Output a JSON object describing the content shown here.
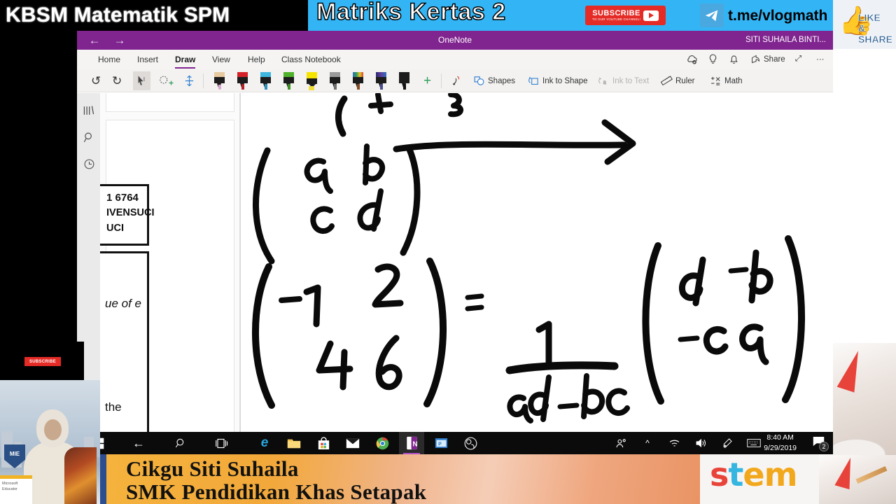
{
  "banner": {
    "channel_title": "KBSM Matematik SPM",
    "topic_title": "Matriks Kertas 2",
    "subscribe_main": "SUBSCRIBE",
    "subscribe_sub": "TO OUR YOUTUBE CHANNEL!",
    "telegram_handle": "t.me/vlogmath",
    "like_share_line1": "LIKE",
    "like_share_line2": "& SHARE"
  },
  "window": {
    "app_title": "OneNote",
    "account_name": "SITI SUHAILA BINTI...",
    "back_arrow": "←",
    "forward_arrow": "→"
  },
  "ribbon": {
    "tabs": [
      {
        "label": "Home",
        "active": false
      },
      {
        "label": "Insert",
        "active": false
      },
      {
        "label": "Draw",
        "active": true
      },
      {
        "label": "View",
        "active": false
      },
      {
        "label": "Help",
        "active": false
      },
      {
        "label": "Class Notebook",
        "active": false
      }
    ],
    "title_icons": [
      {
        "name": "sync-cloud-icon",
        "glyph": "☁"
      },
      {
        "name": "tell-me-lightbulb-icon",
        "glyph": "◯"
      },
      {
        "name": "notifications-bell-icon",
        "glyph": "🔔"
      }
    ],
    "share_label": "Share",
    "expand_glyph": "⤢",
    "more_glyph": "···"
  },
  "toolbar": {
    "undo_glyph": "↺",
    "redo_glyph": "↻",
    "lasso_label": "",
    "eraser_label": "",
    "items": [
      {
        "name": "shapes-button",
        "label": "Shapes"
      },
      {
        "name": "ink-to-shape-button",
        "label": "Ink to Shape"
      },
      {
        "name": "ink-to-text-button",
        "label": "Ink to Text",
        "disabled": true
      },
      {
        "name": "ruler-button",
        "label": "Ruler"
      },
      {
        "name": "math-button",
        "label": "Math"
      }
    ],
    "pens": [
      {
        "name": "pen-pink",
        "cap": "#e7c9a0",
        "nib": "#d9a6d4"
      },
      {
        "name": "pen-red",
        "cap": "#d42027",
        "nib": "#b51f26"
      },
      {
        "name": "pen-cyan",
        "cap": "#3fb6e0",
        "nib": "#2f8fb8"
      },
      {
        "name": "pen-green",
        "cap": "#4fb22a",
        "nib": "#3f8f22"
      },
      {
        "name": "highlighter-yellow",
        "cap": "#f5e400",
        "nib": "#f0df3a"
      },
      {
        "name": "pencil-grey",
        "cap": "#9a9a9a",
        "nib": "#6e6e6e"
      },
      {
        "name": "pen-rainbow",
        "cap": "#8a4b1e",
        "nib": "#8a4b1e"
      },
      {
        "name": "pen-galaxy",
        "cap": "#3b3d8f",
        "nib": "#4a4c8f"
      },
      {
        "name": "pen-black",
        "cap": "#1c1c1c",
        "nib": "#111111"
      }
    ],
    "add_pen_glyph": "+"
  },
  "side_rail": [
    {
      "name": "notebooks-icon",
      "glyph": "▥"
    },
    {
      "name": "search-icon",
      "glyph": "⌕"
    },
    {
      "name": "recent-notes-icon",
      "glyph": "◷"
    }
  ],
  "page_panel": {
    "doc_box_1": [
      "1 6764",
      "IVENSUCI",
      "UCI"
    ],
    "doc_box_2": [
      "ue of e",
      "the"
    ]
  },
  "canvas": {
    "ink_description": "handwritten matrix inverse working",
    "matrix_ab": {
      "a": "a",
      "b": "b",
      "c": "c",
      "d": "d"
    },
    "equation_left": {
      "r1c1": "-1",
      "r1c2": "2",
      "r2c1": "4",
      "r2c2": "6"
    },
    "equals": "=",
    "fraction_numerator": "1",
    "fraction_denominator": "ad-bc",
    "adjugate": {
      "r1c1": "d",
      "r1c2": "-b",
      "r2c1": "-c",
      "r2c2": "a"
    }
  },
  "taskbar": {
    "start_glyph": "⊞",
    "icons": [
      {
        "name": "start-button",
        "glyph": "⊞"
      },
      {
        "name": "back-button",
        "glyph": "←"
      },
      {
        "name": "search-icon",
        "glyph": "⌕"
      },
      {
        "name": "task-view-icon",
        "glyph": "▤"
      },
      {
        "name": "edge-browser-icon",
        "glyph": "e"
      },
      {
        "name": "file-explorer-icon",
        "glyph": "🗀"
      },
      {
        "name": "microsoft-store-icon",
        "glyph": "🛍"
      },
      {
        "name": "mail-icon",
        "glyph": "✉"
      },
      {
        "name": "chrome-icon",
        "glyph": "◉"
      },
      {
        "name": "onenote-icon",
        "glyph": "N"
      },
      {
        "name": "powerpoint-icon",
        "glyph": "P"
      },
      {
        "name": "obs-studio-icon",
        "glyph": "◍"
      }
    ],
    "tray": [
      {
        "name": "people-icon",
        "glyph": "🧍"
      },
      {
        "name": "show-hidden-icons-chevron",
        "glyph": "^"
      },
      {
        "name": "network-wifi-icon",
        "glyph": "📶"
      },
      {
        "name": "volume-icon",
        "glyph": "🔊"
      },
      {
        "name": "pen-menu-icon",
        "glyph": "🖊"
      },
      {
        "name": "touch-keyboard-icon",
        "glyph": "⌨"
      }
    ],
    "time": "8:40 AM",
    "date": "9/29/2019",
    "notification_count": "2"
  },
  "bottom_banner": {
    "line1": "Cikgu Siti Suhaila",
    "line2": "SMK Pendidikan Khas Setapak",
    "stem_word": {
      "s": "s",
      "t": "t",
      "e": "e",
      "m": "m"
    }
  },
  "webcam": {
    "subscribe_badge": "SUBSCRIBE",
    "mie_badge": "MIE",
    "educator_card_line1": "Microsoft",
    "educator_card_line2": "Educator"
  },
  "colors": {
    "onenote_purple": "#80248f",
    "banner_blue": "#33b5f5",
    "accent_red": "#e42b26",
    "taskbar_black": "#0b0b0b"
  }
}
